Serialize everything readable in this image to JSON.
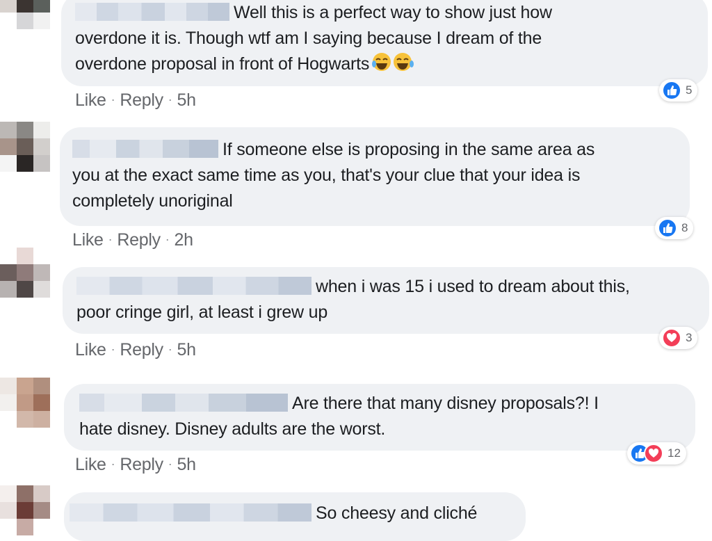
{
  "comments": [
    {
      "text_line1": "Well this is a perfect way to show just how",
      "text_line2": "overdone it is. Though wtf am I saying because I dream of the",
      "text_line3": "overdone proposal in front of Hogwarts",
      "emoji": "laughing-crying-emoji",
      "like_label": "Like",
      "reply_label": "Reply",
      "time": "5h",
      "reaction_count": "5",
      "reactions": [
        "like-icon"
      ]
    },
    {
      "text_line1": "If someone else is proposing in the same area as",
      "text_line2": "you at the exact same time as you, that's your clue that your idea is",
      "text_line3": "completely unoriginal",
      "like_label": "Like",
      "reply_label": "Reply",
      "time": "2h",
      "reaction_count": "8",
      "reactions": [
        "like-icon"
      ]
    },
    {
      "text_line1": "when i was 15 i used to dream about this,",
      "text_line2": "poor cringe girl, at least i grew up",
      "like_label": "Like",
      "reply_label": "Reply",
      "time": "5h",
      "reaction_count": "3",
      "reactions": [
        "love-icon"
      ]
    },
    {
      "text_line1": "Are there that many disney proposals?! I",
      "text_line2": "hate disney. Disney adults are the worst.",
      "like_label": "Like",
      "reply_label": "Reply",
      "time": "5h",
      "reaction_count": "12",
      "reactions": [
        "like-icon",
        "love-icon"
      ]
    },
    {
      "text_line1": "So cheesy and cliché"
    }
  ],
  "colors": {
    "like_blue": "#1877f2",
    "love_red": "#f33e58",
    "bubble_grey": "#eff1f4",
    "meta_grey": "#65676b"
  }
}
